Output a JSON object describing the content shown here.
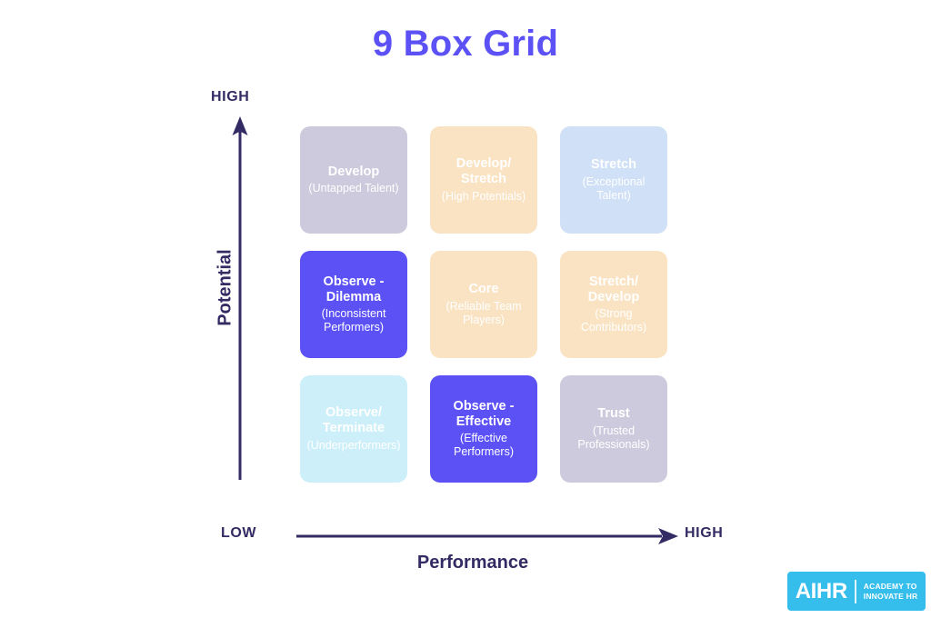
{
  "page": {
    "title": "9 Box Grid",
    "title_color": "#5b51f5",
    "background": "#ffffff"
  },
  "axes": {
    "axis_color": "#332b63",
    "y": {
      "title": "Potential",
      "high_label": "HIGH",
      "arrow_direction": "up"
    },
    "x": {
      "title": "Performance",
      "low_label": "LOW",
      "high_label": "HIGH",
      "arrow_direction": "right"
    }
  },
  "grid": {
    "rows": 3,
    "columns": 3,
    "cells": [
      {
        "title": "Develop",
        "subtitle": "(Untapped Talent)",
        "color": "#cdcadd",
        "text_color": "#ffffff",
        "row": "high-potential",
        "column": "low-performance"
      },
      {
        "title": "Develop/\nStretch",
        "subtitle": "(High Potentials)",
        "color": "#fae3c3",
        "text_color": "#ffffff",
        "row": "high-potential",
        "column": "medium-performance"
      },
      {
        "title": "Stretch",
        "subtitle": "(Exceptional\nTalent)",
        "color": "#cfe0f7",
        "text_color": "#ffffff",
        "row": "high-potential",
        "column": "high-performance"
      },
      {
        "title": "Observe -\nDilemma",
        "subtitle": "(Inconsistent\nPerformers)",
        "color": "#5b51f5",
        "text_color": "#ffffff",
        "row": "medium-potential",
        "column": "low-performance"
      },
      {
        "title": "Core",
        "subtitle": "(Reliable Team\nPlayers)",
        "color": "#fae3c3",
        "text_color": "#ffffff",
        "row": "medium-potential",
        "column": "medium-performance"
      },
      {
        "title": "Stretch/\nDevelop",
        "subtitle": "(Strong\nContributors)",
        "color": "#fae3c3",
        "text_color": "#ffffff",
        "row": "medium-potential",
        "column": "high-performance"
      },
      {
        "title": "Observe/\nTerminate",
        "subtitle": "(Underperformers)",
        "color": "#cdeff9",
        "text_color": "#ffffff",
        "row": "low-potential",
        "column": "low-performance"
      },
      {
        "title": "Observe -\nEffective",
        "subtitle": "(Effective\nPerformers)",
        "color": "#5b51f5",
        "text_color": "#ffffff",
        "row": "low-potential",
        "column": "medium-performance"
      },
      {
        "title": "Trust",
        "subtitle": "(Trusted\nProfessionals)",
        "color": "#cdcadd",
        "text_color": "#ffffff",
        "row": "low-potential",
        "column": "high-performance"
      }
    ]
  },
  "logo": {
    "mark": "AIHR",
    "tagline": "ACADEMY TO\nINNOVATE HR",
    "background": "#35beec",
    "text_color": "#ffffff"
  }
}
